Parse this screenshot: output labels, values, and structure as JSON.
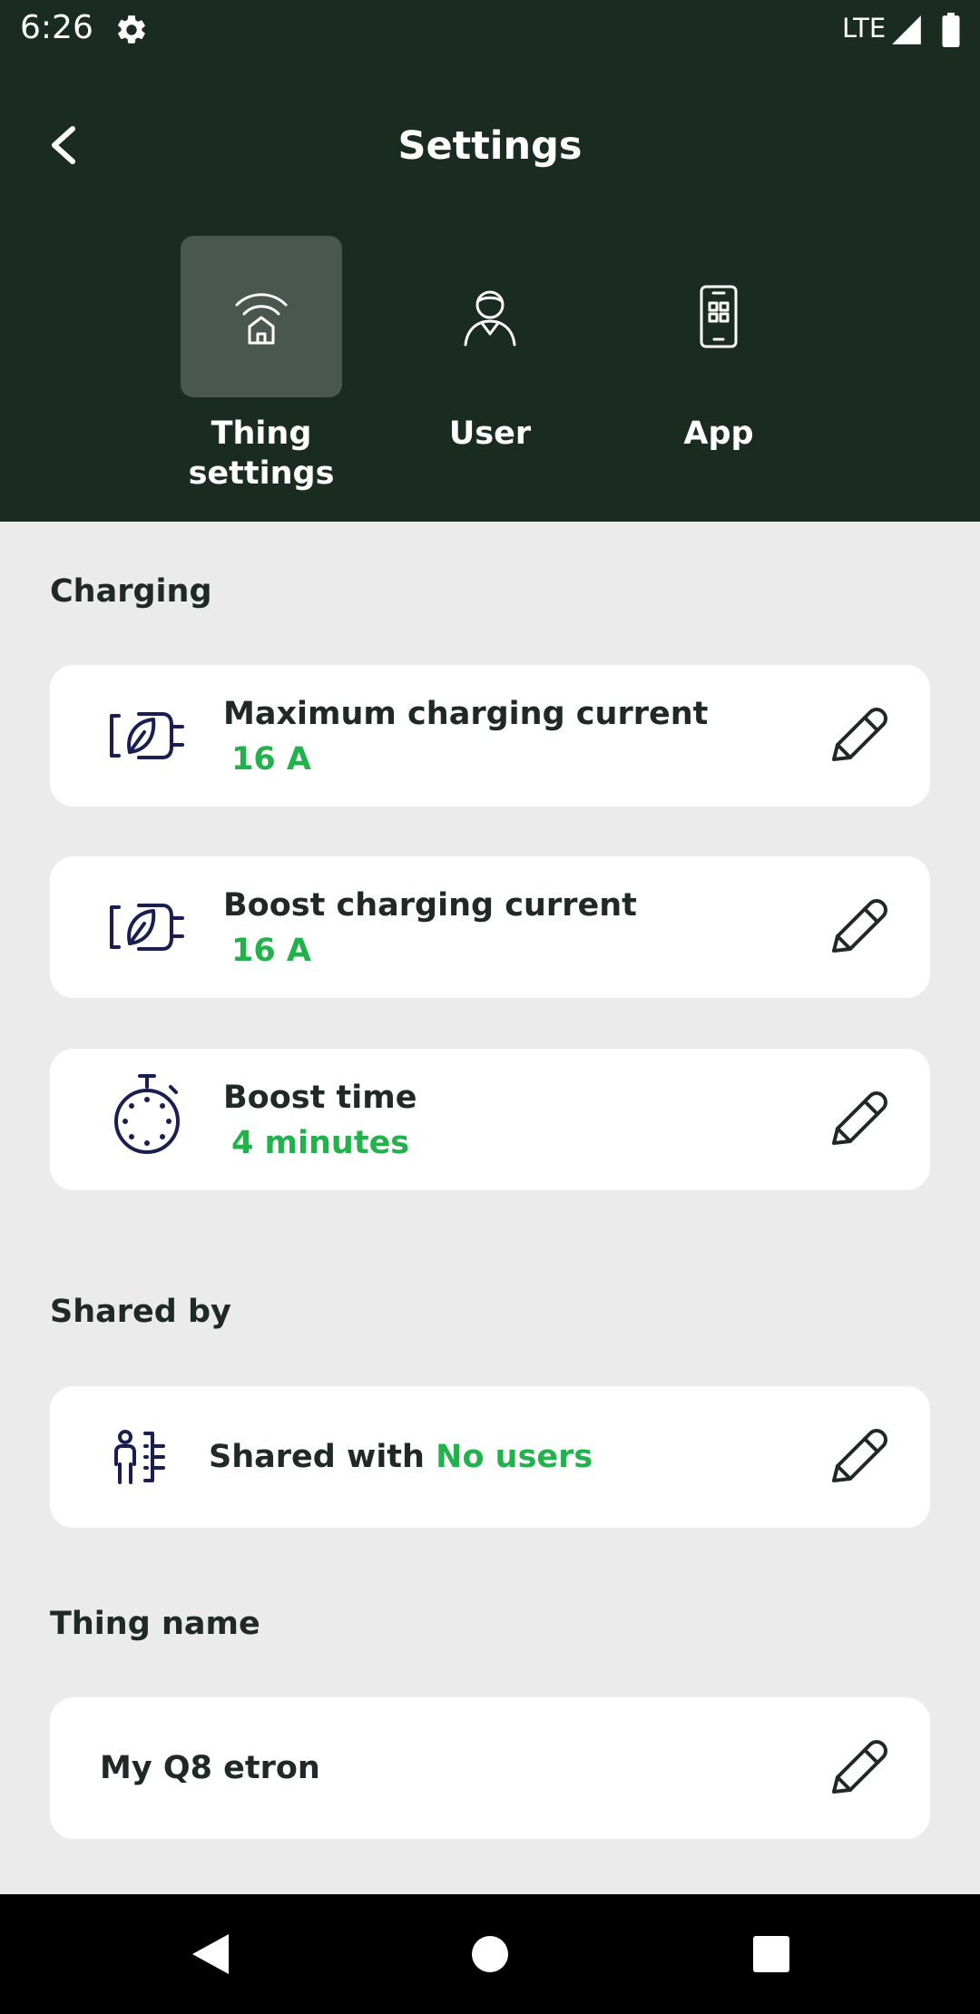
{
  "status_bar": {
    "time": "6:26",
    "network": "LTE"
  },
  "header": {
    "title": "Settings"
  },
  "tabs": [
    {
      "label": "Thing settings",
      "icon": "wifi-home-icon",
      "active": true
    },
    {
      "label": "User",
      "icon": "user-icon",
      "active": false
    },
    {
      "label": "App",
      "icon": "phone-app-icon",
      "active": false
    }
  ],
  "sections": {
    "charging": {
      "title": "Charging",
      "items": [
        {
          "title": "Maximum charging current",
          "value": "16 A",
          "icon": "eco-plug-icon"
        },
        {
          "title": "Boost charging current",
          "value": "16 A",
          "icon": "eco-plug-icon"
        },
        {
          "title": "Boost time",
          "value": "4 minutes",
          "icon": "stopwatch-icon"
        }
      ]
    },
    "shared": {
      "title": "Shared by",
      "label": "Shared with",
      "value": "No users",
      "icon": "shared-users-icon"
    },
    "name": {
      "title": "Thing name",
      "value": "My Q8 etron"
    }
  },
  "colors": {
    "header_bg": "#1a2b22",
    "accent": "#22b24c",
    "icon_navy": "#1a1f52",
    "background": "#ebebeb"
  }
}
